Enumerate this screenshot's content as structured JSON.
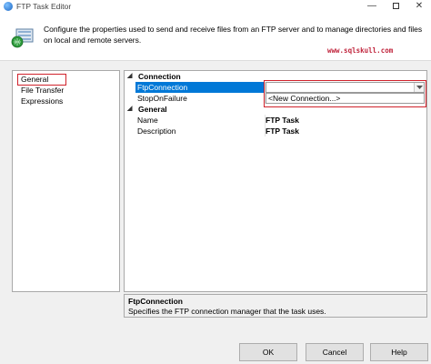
{
  "window": {
    "title": "FTP Task Editor",
    "controls": {
      "minimize": "—",
      "close": "✕"
    }
  },
  "header": {
    "description": "Configure the properties used to send and receive files from an FTP server and to manage directories and files on local and remote servers.",
    "watermark": "www.sqlskull.com"
  },
  "nav": {
    "items": [
      {
        "label": "General",
        "selected": true
      },
      {
        "label": "File Transfer"
      },
      {
        "label": "Expressions"
      }
    ]
  },
  "grid": {
    "categories": [
      {
        "label": "Connection",
        "properties": [
          {
            "name": "FtpConnection",
            "value": "",
            "selected": true
          },
          {
            "name": "StopOnFailure",
            "value": ""
          }
        ]
      },
      {
        "label": "General",
        "properties": [
          {
            "name": "Name",
            "value": "FTP Task"
          },
          {
            "name": "Description",
            "value": "FTP Task"
          }
        ]
      }
    ],
    "dropdown_option": "<New Connection...>"
  },
  "description_panel": {
    "title": "FtpConnection",
    "text": "Specifies the FTP connection manager that the task uses."
  },
  "buttons": {
    "ok": "OK",
    "cancel": "Cancel",
    "help": "Help"
  }
}
